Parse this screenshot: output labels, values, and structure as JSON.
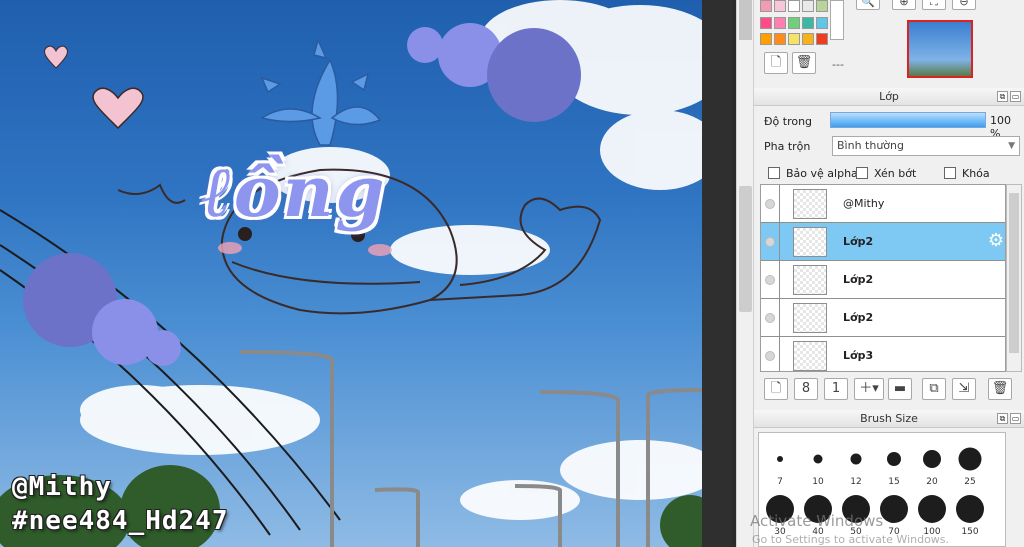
{
  "canvas": {
    "title_art": "ℓồng",
    "watermark_name": "@Mithy",
    "watermark_tag": "#nee484_Hd247",
    "colors": {
      "sky": "#2f74c2",
      "bubble": "#8a8fe8",
      "bubble_dark": "#6b72c7"
    }
  },
  "palette": {
    "swatches": [
      "#f59ab5",
      "#f7c6d9",
      "#ffffff",
      "#e9e9e9",
      "#b9d49a",
      "#ff4b8a",
      "#ff7fb0",
      "#6fd07a",
      "#3cb7a6",
      "#5fc7e5",
      "#ffa000",
      "#ff8c1a",
      "#f4e26b",
      "#f7b21a",
      "#ef3b1f"
    ],
    "dash_label": "---"
  },
  "layer_panel": {
    "title": "Lớp",
    "opacity_label": "Độ trong",
    "opacity_value": "100 %",
    "opacity_fraction": 1.0,
    "blend_label": "Pha trộn",
    "blend_value": "Bình thường",
    "protect_alpha": "Bảo vệ alpha",
    "clipping": "Xén bớt",
    "lock": "Khóa",
    "layers": [
      {
        "name": "@Mithy",
        "selected": false
      },
      {
        "name": "Lớp2",
        "selected": true
      },
      {
        "name": "Lớp2",
        "selected": false
      },
      {
        "name": "Lớp2",
        "selected": false
      },
      {
        "name": "Lớp3",
        "selected": false
      }
    ]
  },
  "brush_panel": {
    "title": "Brush Size",
    "sizes": [
      "7",
      "10",
      "12",
      "15",
      "20",
      "25",
      "30",
      "40",
      "50",
      "70",
      "100",
      "150"
    ]
  },
  "os_watermark": {
    "line1": "Activate Windows",
    "line2": "Go to Settings to activate Windows."
  }
}
